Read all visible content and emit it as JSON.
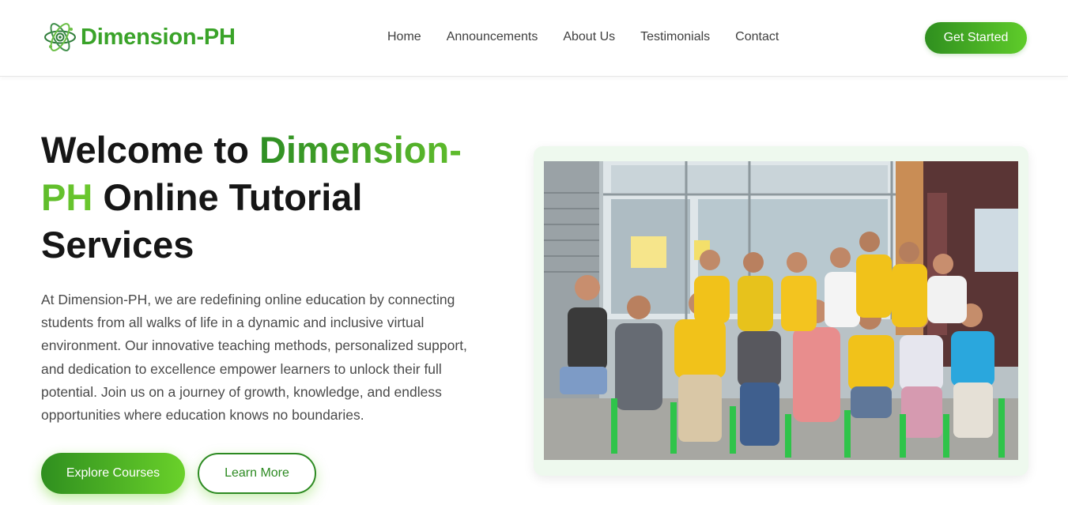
{
  "header": {
    "logo_text": "Dimension-PH",
    "logo_icon": "atom-icon",
    "nav": [
      {
        "label": "Home"
      },
      {
        "label": "Announcements"
      },
      {
        "label": "About Us"
      },
      {
        "label": "Testimonials"
      },
      {
        "label": "Contact"
      }
    ],
    "cta_label": "Get Started"
  },
  "hero": {
    "title_part1": "Welcome to ",
    "title_highlight": "Dimension-PH",
    "title_part2": " Online Tutorial Services",
    "description": "At Dimension-PH, we are redefining online education by connecting students from all walks of life in a dynamic and inclusive virtual environment. Our innovative teaching methods, personalized support, and dedication to excellence empower learners to unlock their full potential. Join us on a journey of growth, knowledge, and endless opportunities where education knows no boundaries.",
    "primary_button": "Explore Courses",
    "secondary_button": "Learn More"
  },
  "colors": {
    "brand_green": "#3aa329",
    "brand_green_dark": "#2d8a22",
    "brand_green_light": "#6ad12a",
    "photo_card_bg": "#eef9ee"
  }
}
